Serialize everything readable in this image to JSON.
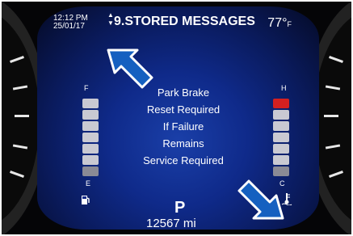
{
  "header": {
    "time": "12:12 PM",
    "date": "25/01/17",
    "title": "9.STORED MESSAGES",
    "temperature": "77°",
    "temperature_unit": "F"
  },
  "message": {
    "lines": [
      "Park Brake",
      "Reset Required",
      "If Failure",
      "Remains",
      "Service Required"
    ]
  },
  "gauges": {
    "fuel_full_label": "F",
    "fuel_empty_label": "E",
    "temp_hot_label": "H",
    "temp_cold_label": "C"
  },
  "footer": {
    "gear": "P",
    "odometer": "12567 mi"
  },
  "icons": {
    "fuel": "fuel-pump-icon",
    "coolant": "coolant-temp-icon",
    "park_brake_warning": "park-brake-warning-icon",
    "pointer_arrows": "callout-arrow-icon"
  },
  "colors": {
    "display_blue": "#1a3fa8",
    "warning_amber": "#f2a011",
    "temp_red": "#d42020"
  }
}
